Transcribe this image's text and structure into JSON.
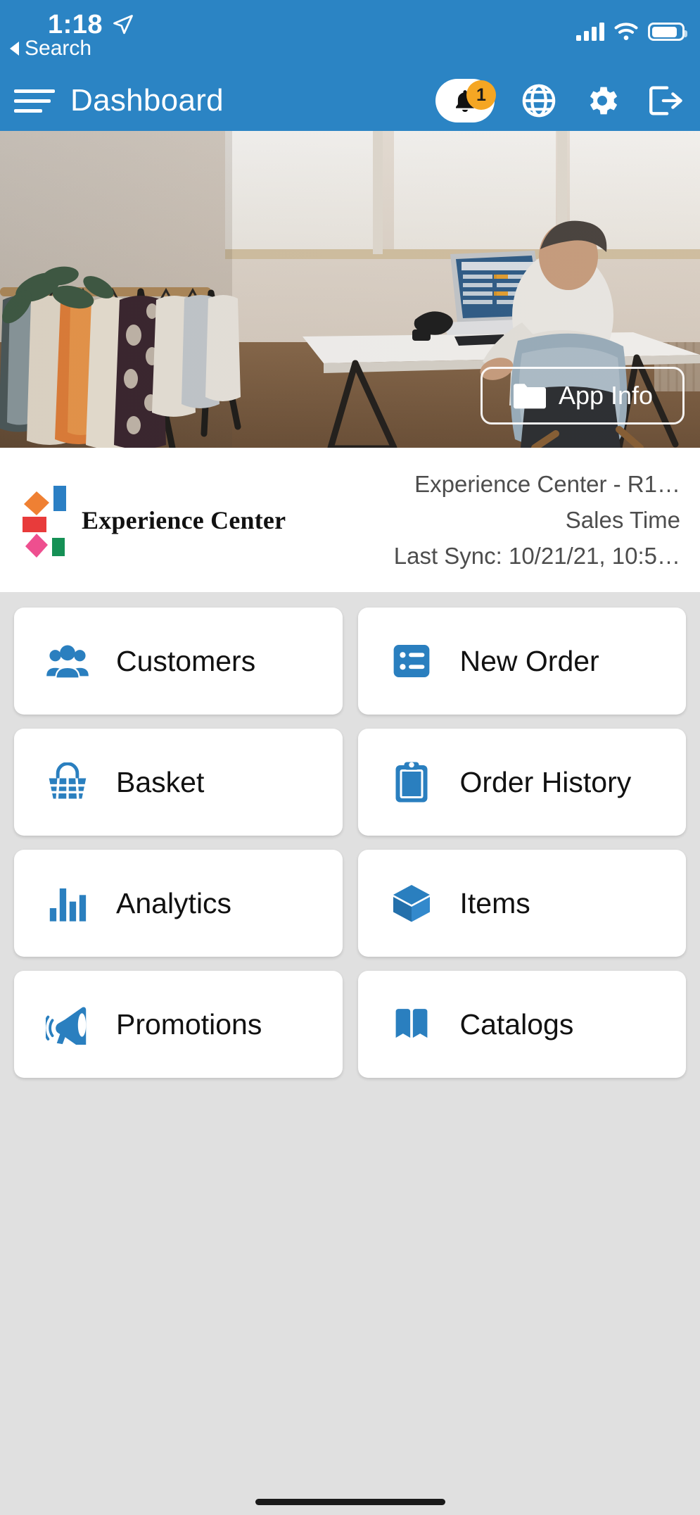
{
  "status_bar": {
    "time": "1:18",
    "location_icon": "location-arrow-icon",
    "back_label": "Search",
    "signal_icon": "cellular-signal-icon",
    "wifi_icon": "wifi-icon",
    "battery_icon": "battery-icon"
  },
  "navbar": {
    "menu_icon": "hamburger-menu-icon",
    "title": "Dashboard",
    "notifications": {
      "icon": "bell-icon",
      "badge": "1"
    },
    "globe": {
      "icon": "globe-icon"
    },
    "settings": {
      "icon": "gear-icon"
    },
    "logout": {
      "icon": "logout-icon"
    }
  },
  "hero": {
    "app_info_label": "App Info",
    "app_info_icon": "folder-icon"
  },
  "company": {
    "logo_name": "Experience Center",
    "title": "Experience Center - R1…",
    "mode": "Sales Time",
    "last_sync": "Last Sync: 10/21/21, 10:5…"
  },
  "grid": {
    "tiles": [
      {
        "label": "Customers",
        "icon": "people-group-icon"
      },
      {
        "label": "New Order",
        "icon": "list-icon"
      },
      {
        "label": "Basket",
        "icon": "basket-icon"
      },
      {
        "label": "Order History",
        "icon": "clipboard-icon"
      },
      {
        "label": "Analytics",
        "icon": "bar-chart-icon"
      },
      {
        "label": "Items",
        "icon": "cube-icon"
      },
      {
        "label": "Promotions",
        "icon": "megaphone-icon"
      },
      {
        "label": "Catalogs",
        "icon": "book-icon"
      }
    ]
  },
  "colors": {
    "brand_blue": "#2b84c4",
    "icon_blue": "#2a7fbf",
    "badge_orange": "#f5a623",
    "page_bg": "#e0e0e0",
    "card_bg": "#ffffff"
  }
}
